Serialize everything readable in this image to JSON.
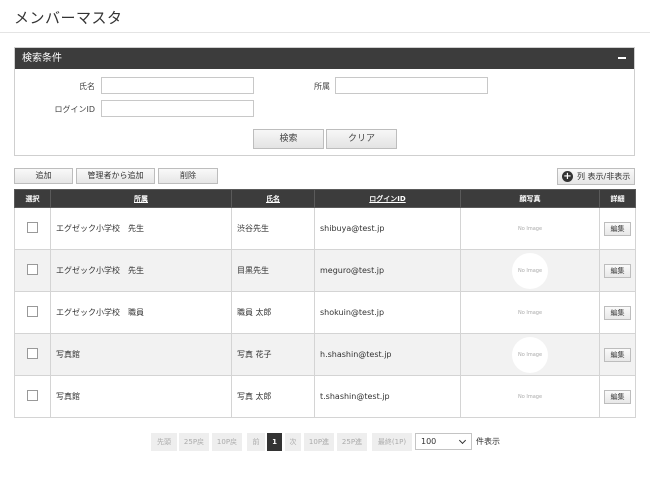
{
  "page": {
    "title": "メンバーマスタ"
  },
  "search": {
    "header": "検索条件",
    "name_label": "氏名",
    "affiliation_label": "所属",
    "login_label": "ログインID",
    "name_value": "",
    "affiliation_value": "",
    "login_value": "",
    "search_button": "検索",
    "clear_button": "クリア"
  },
  "toolbar": {
    "add": "追加",
    "add_from_admin": "管理者から追加",
    "delete": "削除",
    "column_toggle": "列 表示/非表示"
  },
  "table": {
    "headers": {
      "select": "選択",
      "affiliation": "所属",
      "name": "氏名",
      "login_id": "ログインID",
      "photo": "顔写真",
      "detail": "詳細"
    },
    "rows": [
      {
        "affiliation": "エグゼック小学校　先生",
        "name": "渋谷先生",
        "login_id": "shibuya@test.jp",
        "photo": "No Image",
        "detail": "編集"
      },
      {
        "affiliation": "エグゼック小学校　先生",
        "name": "目黒先生",
        "login_id": "meguro@test.jp",
        "photo": "No Image",
        "detail": "編集"
      },
      {
        "affiliation": "エグゼック小学校　職員",
        "name": "職員 太郎",
        "login_id": "shokuin@test.jp",
        "photo": "No Image",
        "detail": "編集"
      },
      {
        "affiliation": "写真館",
        "name": "写真 花子",
        "login_id": "h.shashin@test.jp",
        "photo": "No Image",
        "detail": "編集"
      },
      {
        "affiliation": "写真館",
        "name": "写真 太郎",
        "login_id": "t.shashin@test.jp",
        "photo": "No Image",
        "detail": "編集"
      }
    ]
  },
  "pagination": {
    "first": "先頭",
    "back25": "25P戻",
    "back10": "10P戻",
    "prev": "前",
    "current": "1",
    "next": "次",
    "forward10": "10P進",
    "forward25": "25P進",
    "last": "最終(1P)",
    "per_page_value": "100",
    "per_page_suffix": "件表示"
  }
}
